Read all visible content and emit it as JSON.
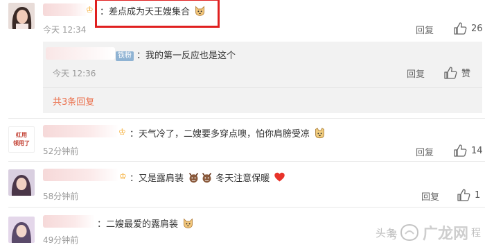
{
  "comments": [
    {
      "text": "：差点成为天王嫂集合",
      "time": "今天 12:34",
      "reply_label": "回复",
      "likes": "26"
    },
    {
      "text": "：天气冷了，二嫂要多穿点噢，怕你肩膀受凉",
      "time": "52分钟前",
      "reply_label": "回复",
      "likes": "14",
      "avatar_text": [
        "红用",
        "领用了"
      ]
    },
    {
      "text_a": "：又是露肩装",
      "text_b": "冬天注意保暖",
      "time": "58分钟前",
      "reply_label": "回复",
      "likes": "1"
    },
    {
      "text": "：二嫂最爱的露肩装",
      "time": "49分钟前"
    }
  ],
  "reply_thread": {
    "badge": "铁粉",
    "text": "：我的第一反应也是这个",
    "time": "今天 12:36",
    "reply_label": "回复",
    "like_label": "赞",
    "more_replies": "共3条回复"
  },
  "watermark": {
    "text_a": "头条",
    "text_b": "广龙网",
    "text_c": "号",
    "text_d": "程"
  },
  "colors": {
    "highlight": "#e02020",
    "more_replies": "#eb7350",
    "badge_bg": "#8fb3d3"
  },
  "icons": [
    "thumbs-up-icon",
    "cat-face-emoji",
    "doge-emoji",
    "devil-emoji",
    "heart-emoji",
    "vip-crown-icon"
  ]
}
